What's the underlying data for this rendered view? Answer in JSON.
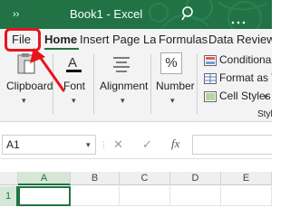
{
  "titlebar": {
    "expand_glyph": "››",
    "title": "Book1  -  Excel",
    "bg_color": "#217346",
    "search_icon": "search-icon",
    "more_icon": "ellipsis-icon"
  },
  "tabs": [
    {
      "label": "File"
    },
    {
      "label": "Home",
      "selected": true
    },
    {
      "label": "Insert"
    },
    {
      "label": "Page Layout"
    },
    {
      "label": "Formulas"
    },
    {
      "label": "Data"
    },
    {
      "label": "Review"
    }
  ],
  "ribbon": {
    "groups": [
      {
        "label": "Clipboard",
        "icon": "clipboard-icon"
      },
      {
        "label": "Font",
        "icon": "font-color-icon"
      },
      {
        "label": "Alignment",
        "icon": "align-icon"
      },
      {
        "label": "Number",
        "icon": "percent-icon",
        "glyph": "%"
      }
    ],
    "styles": {
      "items": [
        {
          "label": "Conditional Formatting"
        },
        {
          "label": "Format as Table"
        },
        {
          "label": "Cell Styles"
        }
      ],
      "group_label": "Styles"
    }
  },
  "formula_bar": {
    "name_box": "A1",
    "cancel_glyph": "✕",
    "enter_glyph": "✓",
    "fx_glyph": "fx",
    "formula": ""
  },
  "grid": {
    "columns": [
      "A",
      "B",
      "C",
      "D",
      "E"
    ],
    "rows": [
      "1"
    ],
    "active_cell": "A1"
  },
  "annotation": {
    "color": "#e8141c",
    "target": "File"
  }
}
